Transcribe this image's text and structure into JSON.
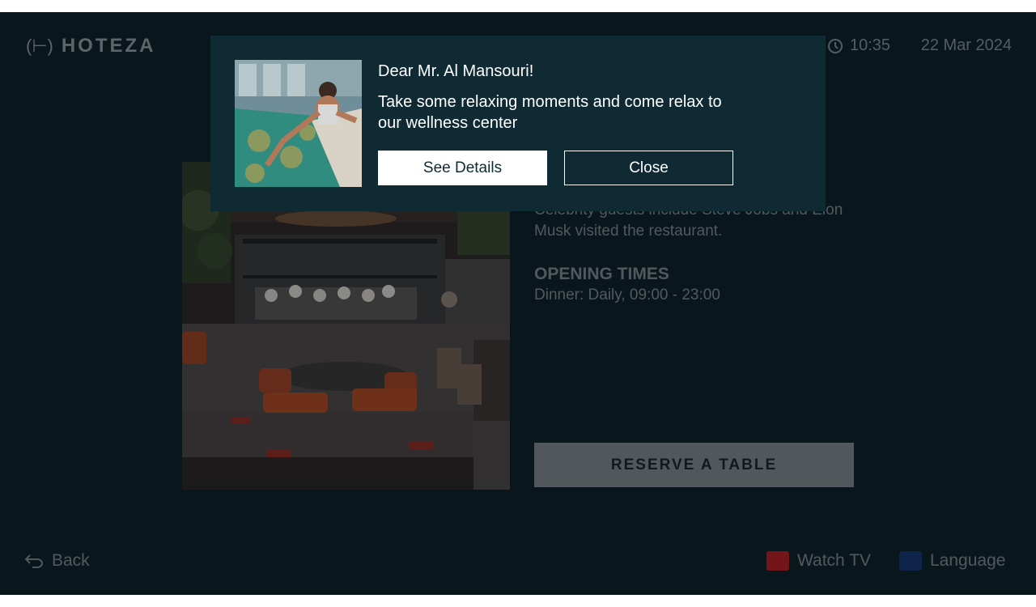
{
  "header": {
    "brand": "HOTEZA",
    "time": "10:35",
    "date": "22 Mar 2024"
  },
  "restaurant": {
    "description": "Celebrity guests include Steve Jobs and Elon Musk visited the restaurant.",
    "opening_title": "OPENING TIMES",
    "opening_text": "Dinner: Daily, 09:00 - 23:00",
    "reserve_label": "RESERVE A TABLE"
  },
  "footer": {
    "back_label": "Back",
    "watch_tv_label": "Watch TV",
    "language_label": "Language"
  },
  "popup": {
    "greeting": "Dear Mr. Al Mansouri!",
    "message": "Take some relaxing moments and come relax to our wellness center",
    "see_details_label": "See Details",
    "close_label": "Close"
  },
  "colors": {
    "background": "#0d1e24",
    "popup_background": "#0f2a33",
    "red_key": "#b01c20",
    "blue_key": "#16336a"
  },
  "icons": {
    "clock": "clock-icon",
    "back": "back-arrow-icon"
  }
}
